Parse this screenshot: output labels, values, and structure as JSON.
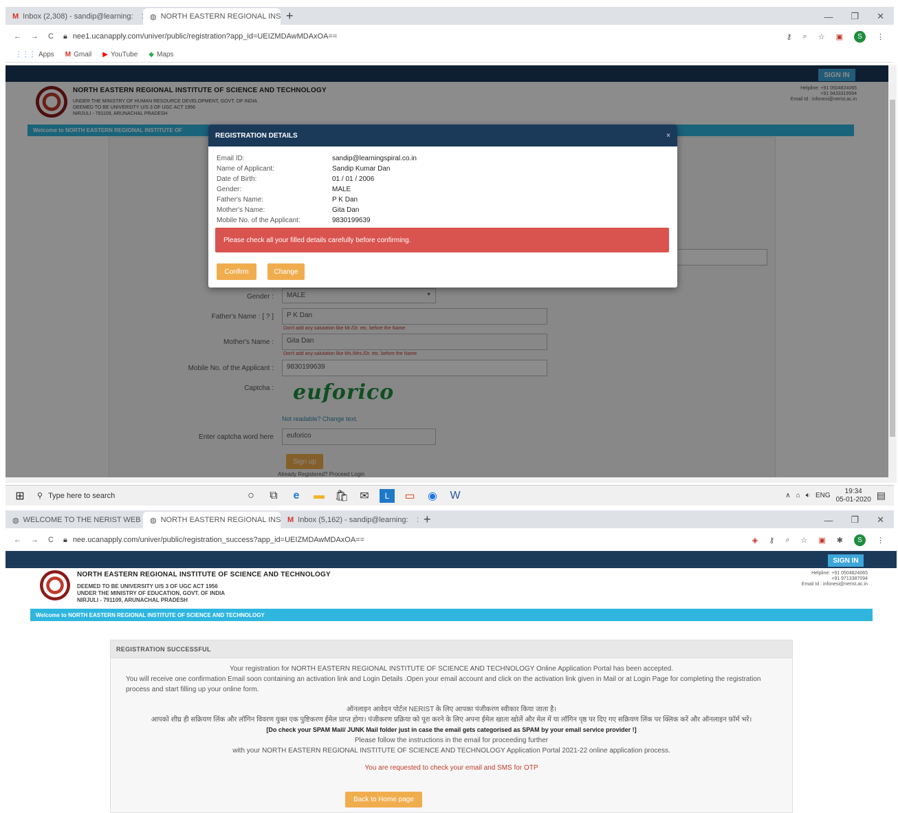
{
  "top": {
    "tabs": [
      {
        "icon": "gmail-icon",
        "label": "Inbox (2,308) - sandip@learning:"
      },
      {
        "icon": "globe-icon",
        "label": "NORTH EASTERN REGIONAL INS"
      }
    ],
    "new_tab": "+",
    "url": "nee1.ucanapply.com/univer/public/registration?app_id=UEIZMDAwMDAxOA==",
    "bookmarks": [
      "Apps",
      "Gmail",
      "YouTube",
      "Maps"
    ],
    "signin": "SIGN IN",
    "institute": {
      "title": "NORTH EASTERN REGIONAL INSTITUTE OF SCIENCE AND TECHNOLOGY",
      "line1": "UNDER THE MINISTRY OF HUMAN RESOURCE DEVELOPMENT, GOVT. OF INDIA",
      "line2": "DEEMED TO BE UNIVERSITY U/S 3 OF UGC ACT 1956",
      "line3": "NIRJULI - 791109, ARUNACHAL PRADESH"
    },
    "helpline": {
      "l1": "Helpline: +91 0504824065",
      "l2": "+91 9433319994",
      "l3": "Email Id : infonesi@nerist.ac.in"
    },
    "welcome": "Welcome to NORTH EASTERN REGIONAL INSTITUTE OF",
    "form": {
      "gender_label": "Gender :",
      "gender_value": "MALE",
      "father_label": "Father's Name : [ ? ]",
      "father_value": "P K Dan",
      "father_hint": "Don't add any salutation like Mr./Dr. etc. before the Name",
      "mother_label": "Mother's Name :",
      "mother_value": "Gita Dan",
      "mother_hint": "Don't add any salutation like Ms./Mrs./Dr. etc. before the Name",
      "mobile_label": "Mobile No. of the Applicant :",
      "mobile_value": "9830199639",
      "captcha_label": "Captcha :",
      "captcha_text": "euforico",
      "captcha_change": "Not readable? Change text.",
      "captcha_entry_label": "Enter captcha word here",
      "captcha_entry_value": "euforico",
      "signup": "Sign up",
      "already": "Already Registered? Proceed Login"
    },
    "modal": {
      "title": "REGISTRATION DETAILS",
      "close": "×",
      "rows": [
        {
          "k": "Email ID:",
          "v": "sandip@learningspiral.co.in"
        },
        {
          "k": "Name of Applicant:",
          "v": "Sandip Kumar Dan"
        },
        {
          "k": "Date of Birth:",
          "v": "01 / 01 / 2006"
        },
        {
          "k": "Gender:",
          "v": "MALE"
        },
        {
          "k": "Father's Name:",
          "v": "P K Dan"
        },
        {
          "k": "Mother's Name:",
          "v": "Gita Dan"
        },
        {
          "k": "Mobile No. of the Applicant:",
          "v": "9830199639"
        }
      ],
      "alert": "Please check all your filled details carefully before confirming.",
      "confirm": "Confirm",
      "change": "Change"
    },
    "taskbar": {
      "search": "Type here to search",
      "lang": "ENG",
      "time": "19:34",
      "date": "05-01-2020"
    }
  },
  "bottom": {
    "tabs": [
      {
        "icon": "globe-icon",
        "label": "WELCOME TO THE NERIST WEB"
      },
      {
        "icon": "globe-icon",
        "label": "NORTH EASTERN REGIONAL INS"
      },
      {
        "icon": "gmail-icon",
        "label": "Inbox (5,162) - sandip@learning:"
      }
    ],
    "new_tab": "+",
    "url": "nee.ucanapply.com/univer/public/registration_success?app_id=UEIZMDAwMDAxOA==",
    "signin": "SIGN IN",
    "institute": {
      "title": "NORTH EASTERN REGIONAL INSTITUTE OF SCIENCE AND TECHNOLOGY",
      "line1": "DEEMED TO BE UNIVERSITY U/S 3 OF UGC ACT 1956",
      "line2": "UNDER THE MINISTRY OF EDUCATION, GOVT. OF INDIA",
      "line3": "NIRJULI - 791109, ARUNACHAL PRADESH"
    },
    "helpline": {
      "l1": "Helpline: +91 0504824065",
      "l2": "+91 9713387094",
      "l3": "Email Id : infonesi@nerist.ac.in"
    },
    "welcome": "Welcome to NORTH EASTERN REGIONAL INSTITUTE OF SCIENCE AND TECHNOLOGY",
    "success": {
      "heading": "REGISTRATION SUCCESSFUL",
      "p1": "Your registration for NORTH EASTERN REGIONAL INSTITUTE OF SCIENCE AND TECHNOLOGY Online Application Portal has been accepted.",
      "p2": "You will receive one confirmation Email soon containing an activation link and Login Details .Open your email account and click on the activation link given in Mail or at Login Page for completing the registration process and start filling up your online form.",
      "hindi1": "ऑनलाइन आवेदन पोर्टल NERIST के लिए आपका पंजीकरण स्वीकार किया जाता है।",
      "hindi2": "आपको शीघ्र ही सक्रियण लिंक और लॉगिन विवरण युक्त एक पुष्टिकरण ईमेल प्राप्त होगा। पंजीकरण प्रक्रिया को पूरा करने के लिए अपना ईमेल खाता खोलें और मेल में या लॉगिन पृष्ठ पर दिए गए सक्रियण लिंक पर क्लिक करें और ऑनलाइन फ़ॉर्म भरें।",
      "spam": "[Do check your SPAM Mail/ JUNK Mail folder just in case the email gets categorised as SPAM by your email service provider !]",
      "follow1": "Please follow the instructions in the email for proceeding further",
      "follow2": "with your NORTH EASTERN REGIONAL INSTITUTE OF SCIENCE AND TECHNOLOGY Application Portal 2021-22 online application process.",
      "otp": "You are requested to check your email and SMS for OTP",
      "back": "Back to Home page"
    }
  },
  "colors": {
    "navy": "#1b3a5a",
    "cyan": "#2fb6de",
    "orange": "#f0ad4e",
    "alert": "#d9534f"
  }
}
